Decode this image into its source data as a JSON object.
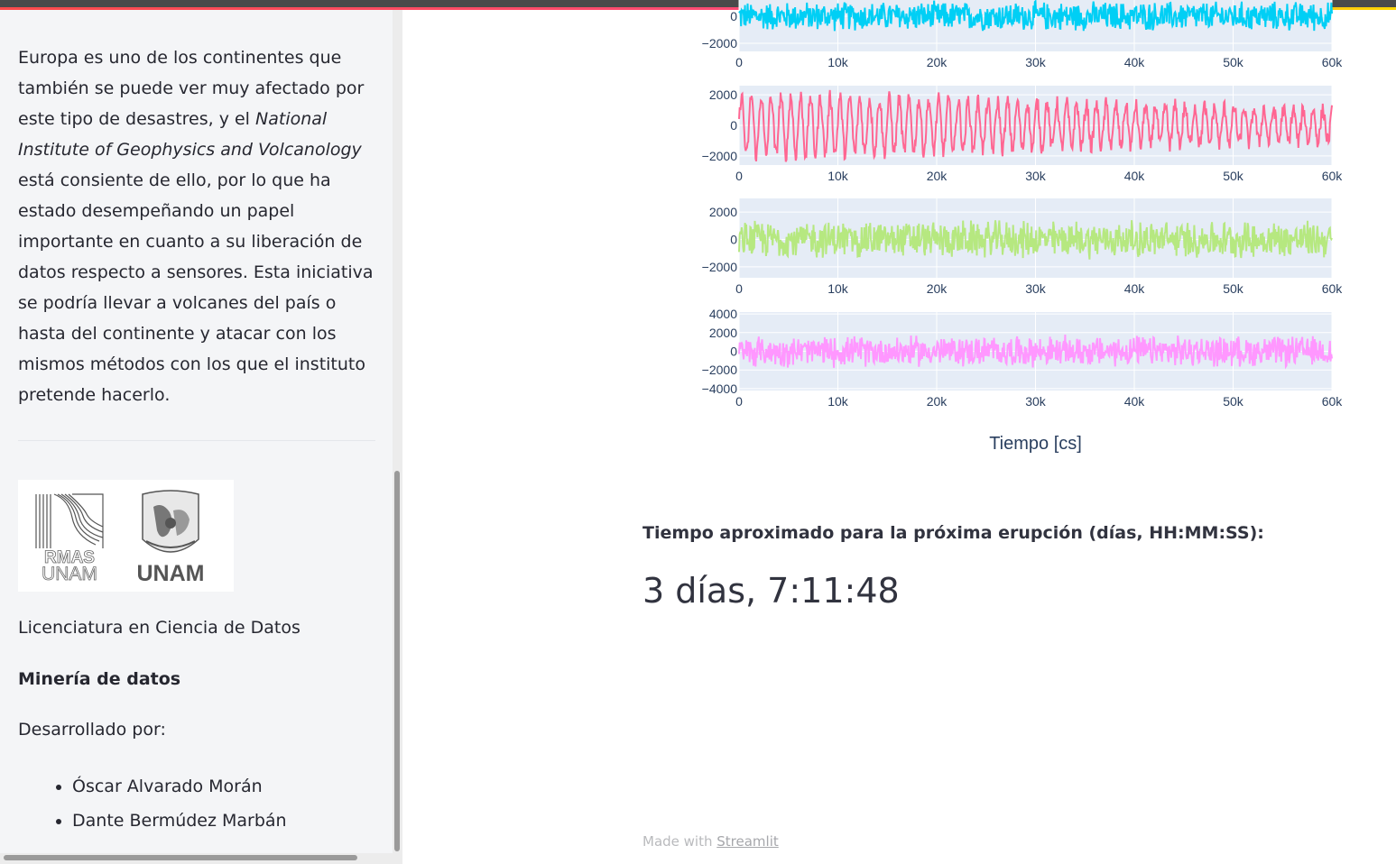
{
  "sidebar": {
    "paragraph": [
      {
        "text": "Europa es uno de los continentes que también se puede ver muy afectado por este tipo de desastres, y el ",
        "italic": false
      },
      {
        "text": "National Institute of Geophysics and Volcanology",
        "italic": true
      },
      {
        "text": " está consiente de ello, por lo que ha estado desempeñando un papel importante en cuanto a su liberación de datos respecto a sensores. Esta iniciativa se podría llevar a volcanes del país o hasta del continente y atacar con los mismos métodos con los que el instituto pretende hacerlo.",
        "italic": false
      }
    ],
    "logos": {
      "left_text": "RMAS UNAM",
      "right_text": "UNAM"
    },
    "career": "Licenciatura en Ciencia de Datos",
    "subject": "Minería de datos",
    "developed_by": "Desarrollado por:",
    "authors": [
      "Óscar Alvarado Morán",
      "Dante Bermúdez Marbán"
    ]
  },
  "main": {
    "label": "Tiempo aproximado para la próxima erupción (días, HH:MM:SS):",
    "countdown": "3 días, 7:11:48",
    "footer_prefix": "Made with",
    "footer_link": "Streamlit"
  },
  "chart_data": {
    "type": "line",
    "xlabel": "Tiempo [cs]",
    "x_ticks": [
      "0",
      "10k",
      "20k",
      "30k",
      "40k",
      "50k",
      "60k"
    ],
    "xlim": [
      0,
      60000
    ],
    "series": [
      {
        "color": "#00cff5",
        "y_ticks": [
          "0",
          "−2000"
        ],
        "ylim": [
          -2600,
          1200
        ],
        "amplitude": 1200,
        "style": "noisy"
      },
      {
        "color": "#ff6692",
        "y_ticks": [
          "2000",
          "0",
          "−2000"
        ],
        "ylim": [
          -2600,
          2600
        ],
        "amplitude": 2000,
        "style": "oscillating"
      },
      {
        "color": "#b6e880",
        "y_ticks": [
          "2000",
          "0",
          "−2000"
        ],
        "ylim": [
          -2800,
          3000
        ],
        "amplitude": 1500,
        "style": "noisy"
      },
      {
        "color": "#ff97ff",
        "y_ticks": [
          "4000",
          "2000",
          "0",
          "−2000",
          "−4000"
        ],
        "ylim": [
          -4200,
          4200
        ],
        "amplitude": 1800,
        "style": "noisy"
      }
    ]
  }
}
